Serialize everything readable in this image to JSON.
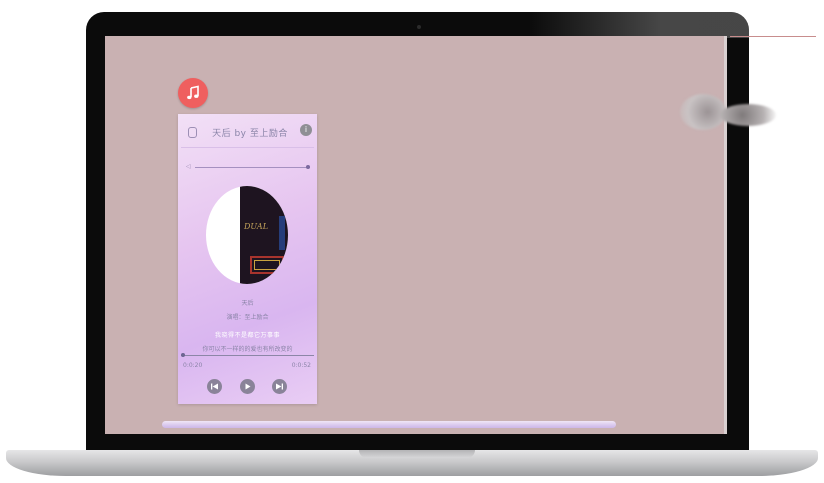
{
  "player": {
    "title": "天后 by 至上励合",
    "song_name": "天后",
    "singer": "演唱：至上励合",
    "lyric_current": "我晓得不是都它万事事",
    "lyric_next": "你可以不一样的的爱也有所改变的",
    "time_current": "0:0:20",
    "time_total": "0:0:52",
    "info_icon": "i",
    "volume_icon": "volume-icon",
    "cover_text": "DUAL"
  },
  "colors": {
    "screen_bg": "#c9b1b2",
    "app_icon": "#ef5f5f",
    "card_gradient_start": "#f2e0f6",
    "card_gradient_end": "#d9b6f0",
    "control_button": "#8a8399"
  }
}
